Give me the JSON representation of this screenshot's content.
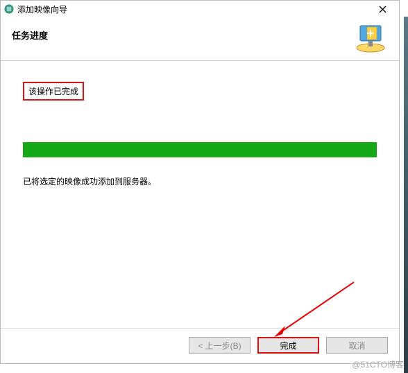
{
  "titlebar": {
    "title": "添加映像向导"
  },
  "header": {
    "heading": "任务进度"
  },
  "content": {
    "status": "该操作已完成",
    "message": "已将选定的映像成功添加到服务器。",
    "progress_percent": 100
  },
  "buttons": {
    "back": "< 上一步(B)",
    "finish": "完成",
    "cancel": "取消"
  },
  "watermark": "@51CTO博客"
}
